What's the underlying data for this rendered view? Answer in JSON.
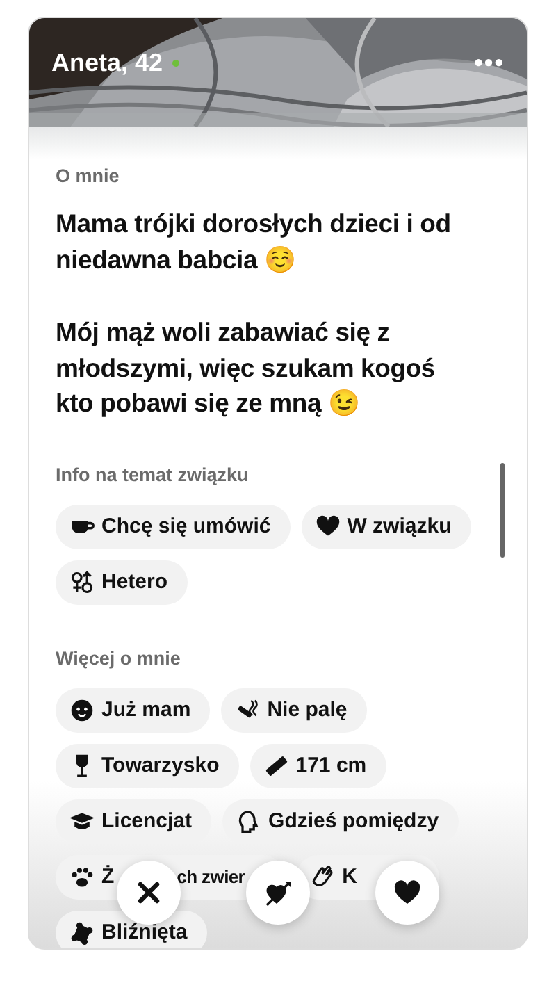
{
  "profile": {
    "name": "Aneta, 42",
    "online": true,
    "menu": "•••"
  },
  "about": {
    "heading": "O mnie",
    "paragraphs": [
      "Mama trójki dorosłych dzieci i od niedawna babcia ☺️",
      "Mój mąż woli zabawiać się z młodszymi, więc szukam kogoś kto pobawi się ze mną 😉"
    ]
  },
  "sections": [
    {
      "heading": "Info na temat związku",
      "tags": [
        {
          "label": "Chcę się umówić"
        },
        {
          "label": "W związku"
        },
        {
          "label": "Hetero"
        }
      ]
    },
    {
      "heading": "Więcej o mnie",
      "tags": [
        {
          "label": "Już mam"
        },
        {
          "label": "Nie palę"
        },
        {
          "label": "Towarzysko"
        },
        {
          "label": "171 cm"
        },
        {
          "label": "Licencjat"
        },
        {
          "label": "Gdzieś pomiędzy"
        },
        {
          "label": "Ż",
          "label_after": "ch zwier"
        },
        {
          "label": "K",
          "covered": true
        },
        {
          "label": "Bliźnięta"
        }
      ]
    }
  ],
  "actions": [
    {
      "kind": "pass"
    },
    {
      "kind": "super"
    },
    {
      "kind": "like"
    }
  ]
}
